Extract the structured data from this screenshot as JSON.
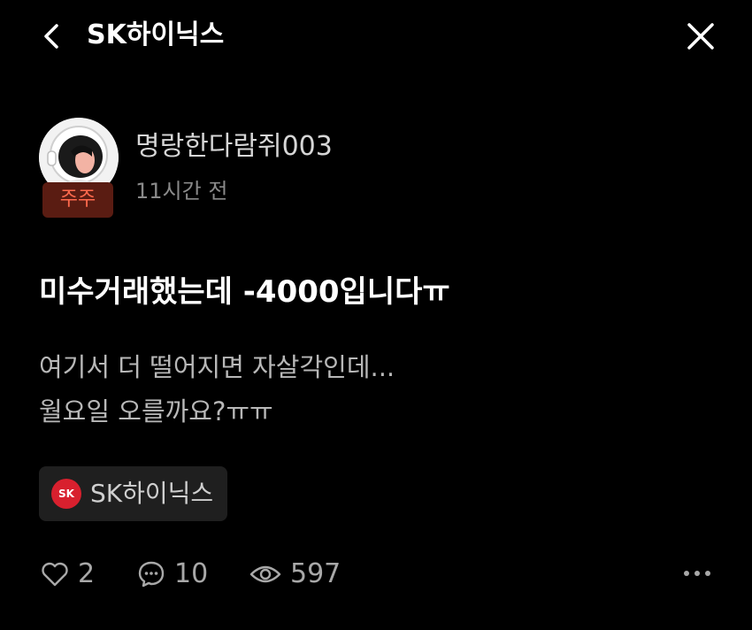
{
  "header": {
    "title": "SK하이닉스",
    "back_icon": "chevron-left-icon",
    "close_icon": "close-icon"
  },
  "author": {
    "name": "명랑한다람쥐003",
    "badge": "주주",
    "time": "11시간 전",
    "avatar_icon": "astronaut-avatar-icon"
  },
  "post": {
    "title": "미수거래했는데 -4000입니다ㅠ",
    "body_lines": [
      "여기서 더 떨어지면 자살각인데...",
      "월요일 오를까요?ㅠㅠ"
    ]
  },
  "tag": {
    "logo_text": "SK",
    "label": "SK하이닉스"
  },
  "stats": {
    "likes": "2",
    "comments": "10",
    "views": "597"
  },
  "colors": {
    "background": "#000000",
    "badge_bg": "#5a1c12",
    "badge_text": "#ff6a4d",
    "brand_red": "#d8202e",
    "chip_bg": "#1f1f1f"
  }
}
